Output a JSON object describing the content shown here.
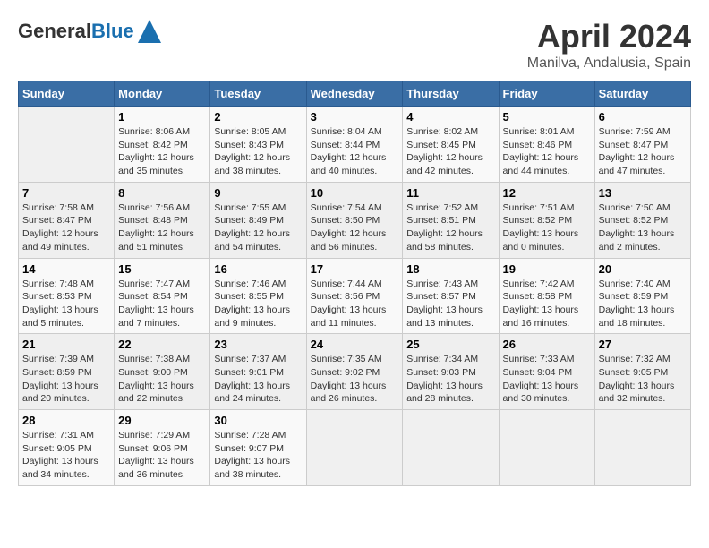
{
  "header": {
    "logo_general": "General",
    "logo_blue": "Blue",
    "month": "April 2024",
    "location": "Manilva, Andalusia, Spain"
  },
  "columns": [
    "Sunday",
    "Monday",
    "Tuesday",
    "Wednesday",
    "Thursday",
    "Friday",
    "Saturday"
  ],
  "weeks": [
    [
      {
        "day": "",
        "info": ""
      },
      {
        "day": "1",
        "info": "Sunrise: 8:06 AM\nSunset: 8:42 PM\nDaylight: 12 hours\nand 35 minutes."
      },
      {
        "day": "2",
        "info": "Sunrise: 8:05 AM\nSunset: 8:43 PM\nDaylight: 12 hours\nand 38 minutes."
      },
      {
        "day": "3",
        "info": "Sunrise: 8:04 AM\nSunset: 8:44 PM\nDaylight: 12 hours\nand 40 minutes."
      },
      {
        "day": "4",
        "info": "Sunrise: 8:02 AM\nSunset: 8:45 PM\nDaylight: 12 hours\nand 42 minutes."
      },
      {
        "day": "5",
        "info": "Sunrise: 8:01 AM\nSunset: 8:46 PM\nDaylight: 12 hours\nand 44 minutes."
      },
      {
        "day": "6",
        "info": "Sunrise: 7:59 AM\nSunset: 8:47 PM\nDaylight: 12 hours\nand 47 minutes."
      }
    ],
    [
      {
        "day": "7",
        "info": "Sunrise: 7:58 AM\nSunset: 8:47 PM\nDaylight: 12 hours\nand 49 minutes."
      },
      {
        "day": "8",
        "info": "Sunrise: 7:56 AM\nSunset: 8:48 PM\nDaylight: 12 hours\nand 51 minutes."
      },
      {
        "day": "9",
        "info": "Sunrise: 7:55 AM\nSunset: 8:49 PM\nDaylight: 12 hours\nand 54 minutes."
      },
      {
        "day": "10",
        "info": "Sunrise: 7:54 AM\nSunset: 8:50 PM\nDaylight: 12 hours\nand 56 minutes."
      },
      {
        "day": "11",
        "info": "Sunrise: 7:52 AM\nSunset: 8:51 PM\nDaylight: 12 hours\nand 58 minutes."
      },
      {
        "day": "12",
        "info": "Sunrise: 7:51 AM\nSunset: 8:52 PM\nDaylight: 13 hours\nand 0 minutes."
      },
      {
        "day": "13",
        "info": "Sunrise: 7:50 AM\nSunset: 8:52 PM\nDaylight: 13 hours\nand 2 minutes."
      }
    ],
    [
      {
        "day": "14",
        "info": "Sunrise: 7:48 AM\nSunset: 8:53 PM\nDaylight: 13 hours\nand 5 minutes."
      },
      {
        "day": "15",
        "info": "Sunrise: 7:47 AM\nSunset: 8:54 PM\nDaylight: 13 hours\nand 7 minutes."
      },
      {
        "day": "16",
        "info": "Sunrise: 7:46 AM\nSunset: 8:55 PM\nDaylight: 13 hours\nand 9 minutes."
      },
      {
        "day": "17",
        "info": "Sunrise: 7:44 AM\nSunset: 8:56 PM\nDaylight: 13 hours\nand 11 minutes."
      },
      {
        "day": "18",
        "info": "Sunrise: 7:43 AM\nSunset: 8:57 PM\nDaylight: 13 hours\nand 13 minutes."
      },
      {
        "day": "19",
        "info": "Sunrise: 7:42 AM\nSunset: 8:58 PM\nDaylight: 13 hours\nand 16 minutes."
      },
      {
        "day": "20",
        "info": "Sunrise: 7:40 AM\nSunset: 8:59 PM\nDaylight: 13 hours\nand 18 minutes."
      }
    ],
    [
      {
        "day": "21",
        "info": "Sunrise: 7:39 AM\nSunset: 8:59 PM\nDaylight: 13 hours\nand 20 minutes."
      },
      {
        "day": "22",
        "info": "Sunrise: 7:38 AM\nSunset: 9:00 PM\nDaylight: 13 hours\nand 22 minutes."
      },
      {
        "day": "23",
        "info": "Sunrise: 7:37 AM\nSunset: 9:01 PM\nDaylight: 13 hours\nand 24 minutes."
      },
      {
        "day": "24",
        "info": "Sunrise: 7:35 AM\nSunset: 9:02 PM\nDaylight: 13 hours\nand 26 minutes."
      },
      {
        "day": "25",
        "info": "Sunrise: 7:34 AM\nSunset: 9:03 PM\nDaylight: 13 hours\nand 28 minutes."
      },
      {
        "day": "26",
        "info": "Sunrise: 7:33 AM\nSunset: 9:04 PM\nDaylight: 13 hours\nand 30 minutes."
      },
      {
        "day": "27",
        "info": "Sunrise: 7:32 AM\nSunset: 9:05 PM\nDaylight: 13 hours\nand 32 minutes."
      }
    ],
    [
      {
        "day": "28",
        "info": "Sunrise: 7:31 AM\nSunset: 9:05 PM\nDaylight: 13 hours\nand 34 minutes."
      },
      {
        "day": "29",
        "info": "Sunrise: 7:29 AM\nSunset: 9:06 PM\nDaylight: 13 hours\nand 36 minutes."
      },
      {
        "day": "30",
        "info": "Sunrise: 7:28 AM\nSunset: 9:07 PM\nDaylight: 13 hours\nand 38 minutes."
      },
      {
        "day": "",
        "info": ""
      },
      {
        "day": "",
        "info": ""
      },
      {
        "day": "",
        "info": ""
      },
      {
        "day": "",
        "info": ""
      }
    ]
  ]
}
